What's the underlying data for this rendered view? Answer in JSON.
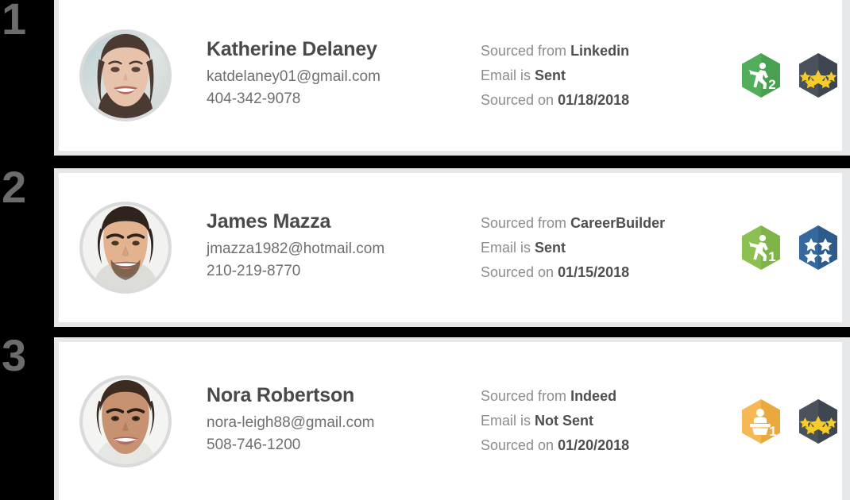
{
  "list": {
    "rows": [
      {
        "rank": "1",
        "avatar_name": "avatar-katherine-delaney",
        "name": "Katherine Delaney",
        "email": "katdelaney01@gmail.com",
        "phone": "404-342-9078",
        "sourced_from_label": "Sourced from",
        "sourced_from_value": "Linkedin",
        "email_status_label": "Email is",
        "email_status_value": "Sent",
        "sourced_on_label": "Sourced on",
        "sourced_on_value": "01/18/2018",
        "activity_badge": {
          "icon": "running-person-hex-badge",
          "count": "2",
          "color": "#52ae5b",
          "color_dark": "#48a050"
        },
        "rating_badge": {
          "icon": "five-star-hex-badge",
          "stars": 5,
          "star_color": "#f5cc2a",
          "color": "#4a525c",
          "color_dark": "#3e4650"
        }
      },
      {
        "rank": "2",
        "avatar_name": "avatar-james-mazza",
        "name": "James Mazza",
        "email": "jmazza1982@hotmail.com",
        "phone": "210-219-8770",
        "sourced_from_label": "Sourced from",
        "sourced_from_value": "CareerBuilder",
        "email_status_label": "Email is",
        "email_status_value": "Sent",
        "sourced_on_label": "Sourced on",
        "sourced_on_value": "01/15/2018",
        "activity_badge": {
          "icon": "running-person-hex-badge",
          "count": "1",
          "color": "#8cc152",
          "color_dark": "#7fb548"
        },
        "rating_badge": {
          "icon": "four-star-hex-badge",
          "stars": 4,
          "star_color": "#ffffff",
          "color": "#35699e",
          "color_dark": "#2d5b8c"
        }
      },
      {
        "rank": "3",
        "avatar_name": "avatar-nora-robertson",
        "name": "Nora Robertson",
        "email": "nora-leigh88@gmail.com",
        "phone": "508-746-1200",
        "sourced_from_label": "Sourced from",
        "sourced_from_value": "Indeed",
        "email_status_label": "Email is",
        "email_status_value": "Not Sent",
        "sourced_on_label": "Sourced on",
        "sourced_on_value": "01/20/2018",
        "activity_badge": {
          "icon": "speaker-person-hex-badge",
          "count": "1",
          "color": "#f5b854",
          "color_dark": "#eaa93f"
        },
        "rating_badge": {
          "icon": "five-star-hex-badge",
          "stars": 5,
          "star_color": "#f5cc2a",
          "color": "#4a525c",
          "color_dark": "#3e4650"
        }
      }
    ]
  },
  "theme": {
    "page_background": "#000000",
    "card_background": "#ffffff",
    "card_border": "#e6e8ea",
    "rank_color": "#6c6c6c",
    "name_color": "#4a4a4a",
    "muted_text": "#8a8c8e",
    "value_text": "#4d4f51"
  }
}
